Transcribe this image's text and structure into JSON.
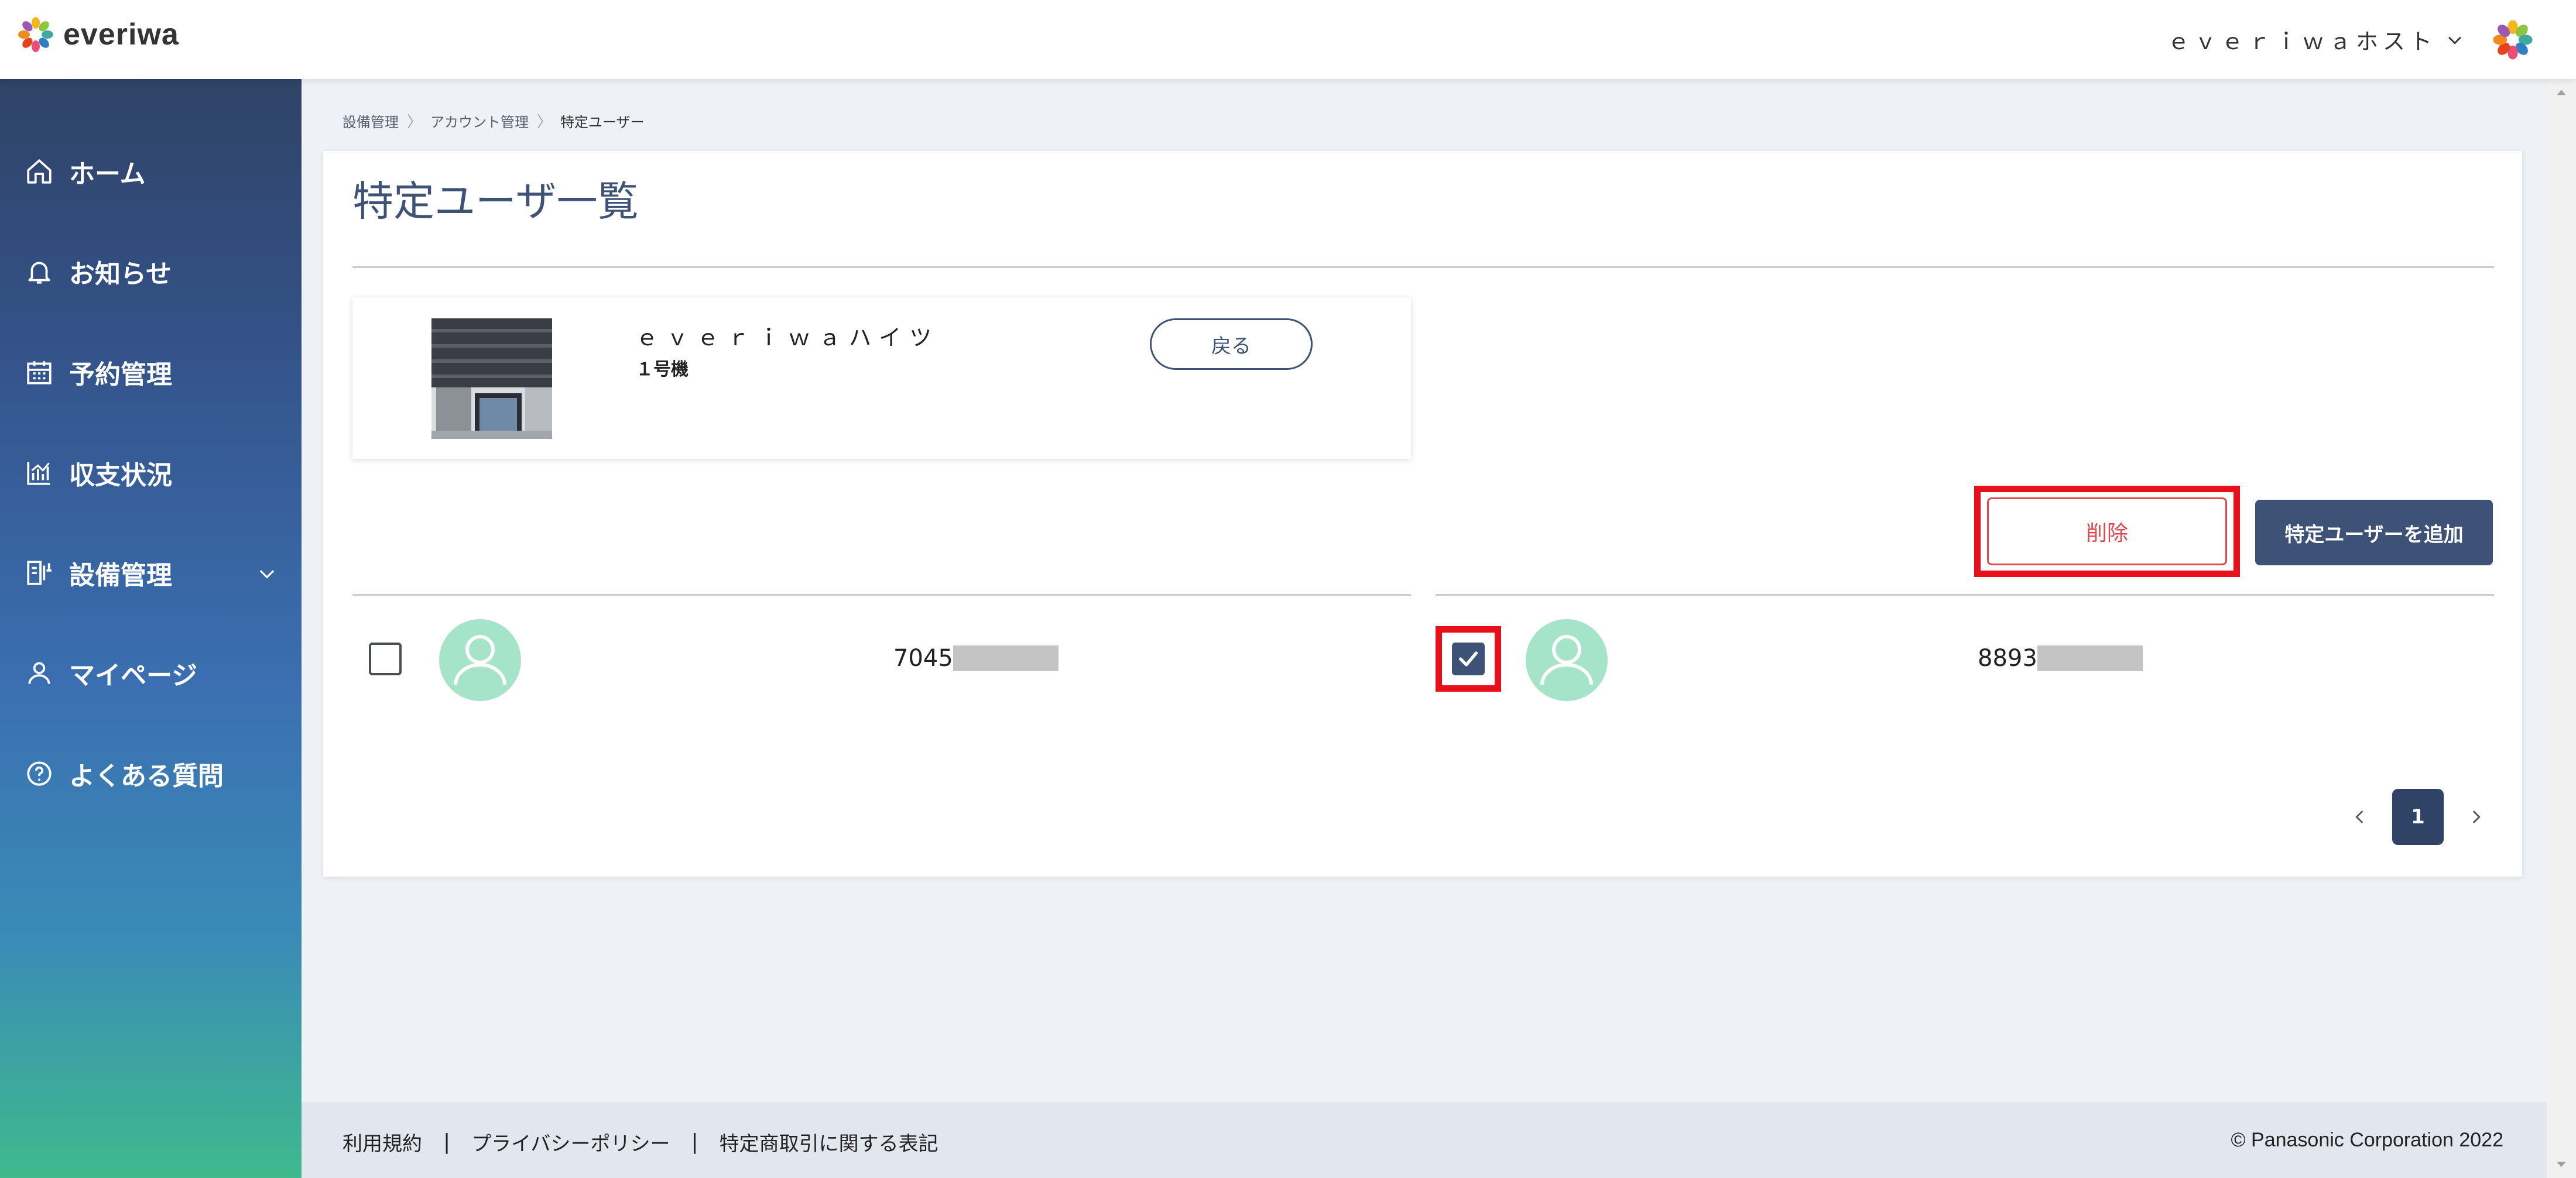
{
  "app": {
    "logo_text": "everiwa",
    "user_menu_label": "ｅｖｅｒｉｗａホスト"
  },
  "sidebar": {
    "items": [
      {
        "label": "ホーム",
        "icon": "home-icon"
      },
      {
        "label": "お知らせ",
        "icon": "bell-icon"
      },
      {
        "label": "予約管理",
        "icon": "calendar-icon"
      },
      {
        "label": "収支状況",
        "icon": "chart-icon"
      },
      {
        "label": "設備管理",
        "icon": "equipment-icon"
      },
      {
        "label": "マイページ",
        "icon": "person-icon"
      },
      {
        "label": "よくある質問",
        "icon": "question-icon"
      }
    ]
  },
  "breadcrumb": {
    "items": [
      "設備管理",
      "アカウント管理",
      "特定ユーザー"
    ]
  },
  "page": {
    "title": "特定ユーザ一覧"
  },
  "facility": {
    "name": "ｅｖｅｒｉｗａハイツ",
    "unit": "１号機",
    "back_label": "戻る"
  },
  "actions": {
    "delete_label": "削除",
    "add_label": "特定ユーザーを追加"
  },
  "users": [
    {
      "id_prefix": "7045",
      "checked": false
    },
    {
      "id_prefix": "8893",
      "checked": true
    }
  ],
  "pagination": {
    "current": "1"
  },
  "footer": {
    "links": [
      "利用規約",
      "プライバシーポリシー",
      "特定商取引に関する表記"
    ],
    "separator": "|",
    "copyright": "© Panasonic Corporation 2022"
  },
  "colors": {
    "primary": "#3e5278",
    "delete": "#e2474f",
    "highlight": "#e8101b",
    "avatar": "#a6e4c9"
  }
}
